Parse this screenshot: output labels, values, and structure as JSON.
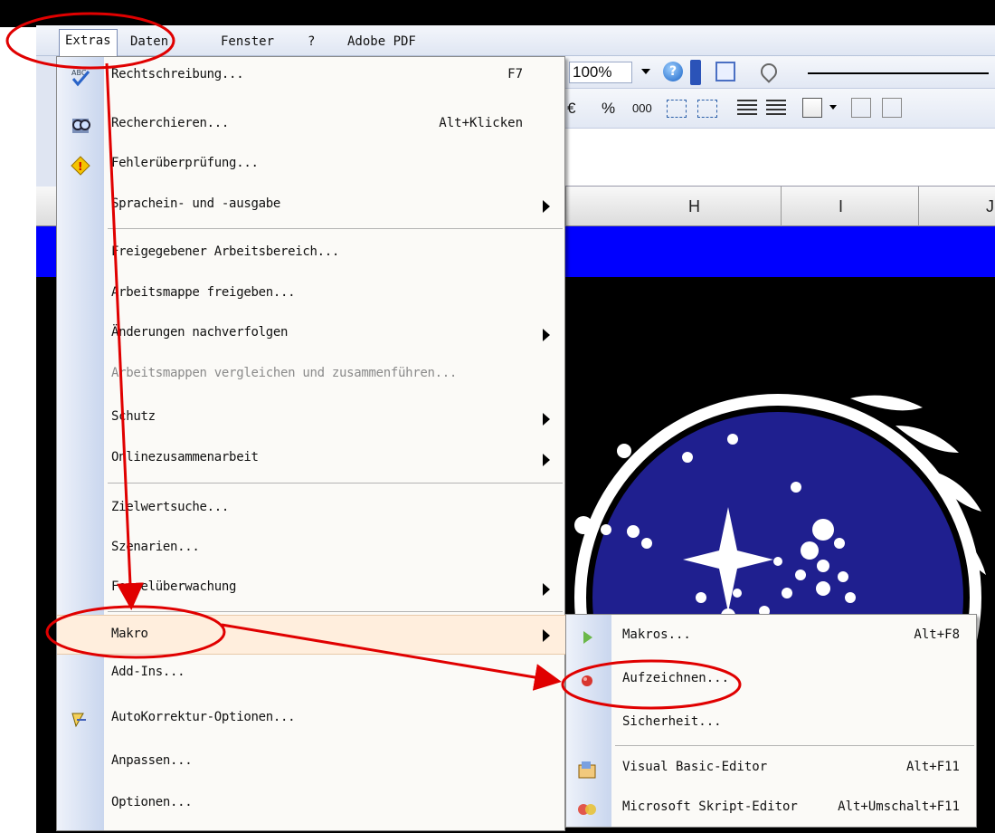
{
  "menubar": {
    "items": [
      {
        "label": "Extras"
      },
      {
        "label": "Daten"
      },
      {
        "label": "Fenster"
      },
      {
        "label": "?"
      },
      {
        "label": "Adobe PDF"
      }
    ]
  },
  "toolbar": {
    "zoom": "100%",
    "currency": "€",
    "percent": "%",
    "thousands": "000"
  },
  "columns": [
    "H",
    "I",
    "J"
  ],
  "extras_menu": {
    "items": [
      {
        "label": "Rechtschreibung...",
        "shortcut": "F7",
        "icon": "spellcheck-icon"
      },
      {
        "label": "Recherchieren...",
        "shortcut": "Alt+Klicken",
        "icon": "research-icon"
      },
      {
        "label": "Fehlerüberprüfung...",
        "icon": "error-check-icon"
      },
      {
        "label": "Sprachein- und -ausgabe"
      },
      {
        "label": "Freigegebener Arbeitsbereich..."
      },
      {
        "label": "Arbeitsmappe freigeben..."
      },
      {
        "label": "Änderungen nachverfolgen"
      },
      {
        "label": "Arbeitsmappen vergleichen und zusammenführen...",
        "disabled": true
      },
      {
        "label": "Schutz"
      },
      {
        "label": "Onlinezusammenarbeit"
      },
      {
        "label": "Zielwertsuche..."
      },
      {
        "label": "Szenarien..."
      },
      {
        "label": "Formelüberwachung"
      },
      {
        "label": "Makro"
      },
      {
        "label": "Add-Ins..."
      },
      {
        "label": "AutoKorrektur-Optionen...",
        "icon": "autocorrect-icon"
      },
      {
        "label": "Anpassen..."
      },
      {
        "label": "Optionen..."
      }
    ]
  },
  "makro_submenu": {
    "items": [
      {
        "label": "Makros...",
        "shortcut": "Alt+F8",
        "icon": "play-icon"
      },
      {
        "label": "Aufzeichnen...",
        "icon": "record-icon"
      },
      {
        "label": "Sicherheit..."
      },
      {
        "label": "Visual Basic-Editor",
        "shortcut": "Alt+F11",
        "icon": "vb-editor-icon"
      },
      {
        "label": "Microsoft Skript-Editor",
        "shortcut": "Alt+Umschalt+F11",
        "icon": "script-editor-icon"
      }
    ]
  },
  "colors": {
    "highlight": "#ffeedd",
    "annotation": "#e00000",
    "blue_row": "#0000ff",
    "emblem_blue": "#1f1f8f"
  }
}
